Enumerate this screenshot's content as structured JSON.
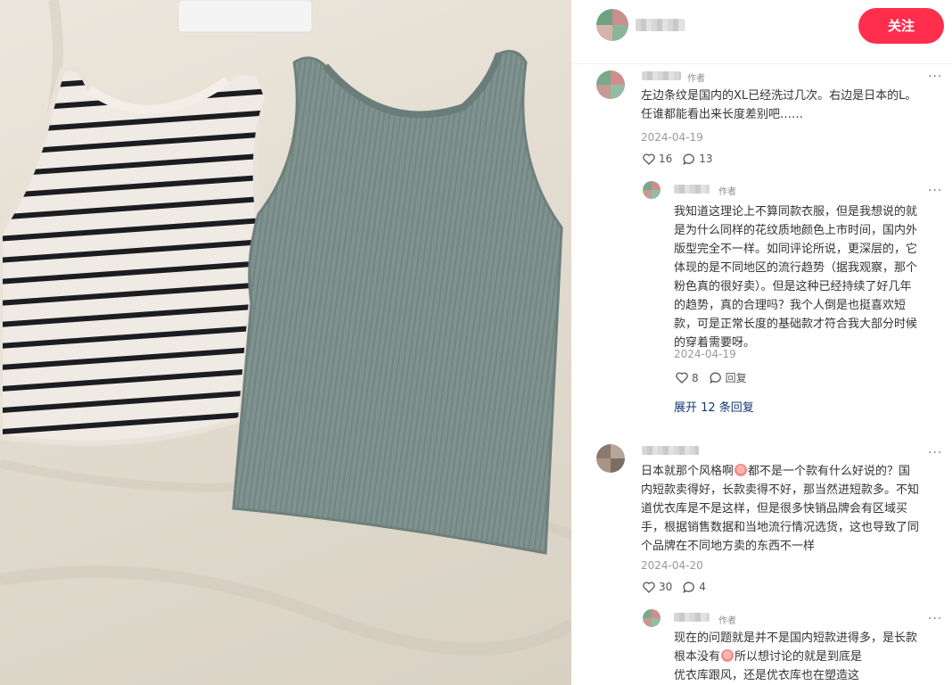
{
  "header": {
    "follow_label": "关注"
  },
  "comments": [
    {
      "author_tag": "作者",
      "text_lines": [
        "左边条纹是国内的XL已经洗过几次。右边是日本的L。",
        "任谁都能看出来长度差别吧……"
      ],
      "date": "2024-04-19",
      "likes": "16",
      "replies": "13",
      "sub": {
        "author_tag": "作者",
        "text_lines": [
          "我知道这理论上不算同款衣服，但是我想说的就",
          "是为什么同样的花纹质地颜色上市时间，国内外",
          "版型完全不一样。如同评论所说，更深层的，它",
          "体现的是不同地区的流行趋势（据我观察，那个",
          "粉色真的很好卖）。但是这种已经持续了好几年",
          "的趋势，真的合理吗？我个人倒是也挺喜欢短",
          "款，可是正常长度的基础款才符合我大部分时候",
          "的穿着需要呀。"
        ],
        "date": "2024-04-19",
        "likes": "8",
        "reply_label": "回复"
      },
      "expand_label": "展开 12 条回复"
    },
    {
      "text_line1_a": "日本就那个风格啊",
      "text_line1_b": "都不是一个款有什么好说的？国",
      "text_lines": [
        "内短款卖得好，长款卖得不好，那当然进短款多。不知",
        "道优衣库是不是这样，但是很多快销品牌会有区域买",
        "手，根据销售数据和当地流行情况选货，这也导致了同",
        "个品牌在不同地方卖的东西不一样"
      ],
      "date": "2024-04-20",
      "likes": "30",
      "replies": "4",
      "sub": {
        "author_tag": "作者",
        "line1": "现在的问题就是并不是国内短款进得多，是长款",
        "line2_a": "根本没有",
        "line2_b": "所以想讨论的就是到底是",
        "line3": "优衣库跟风，还是优衣库也在塑造这"
      }
    }
  ],
  "icons": {
    "like": "heart-outline-icon",
    "comment": "comment-bubble-icon",
    "more": "more-dots-icon",
    "emoji": "embarrassed-face-emoji"
  },
  "colors": {
    "follow_button": "#ff2e4d",
    "expand_link": "#13386c",
    "muted_text": "#999999"
  }
}
